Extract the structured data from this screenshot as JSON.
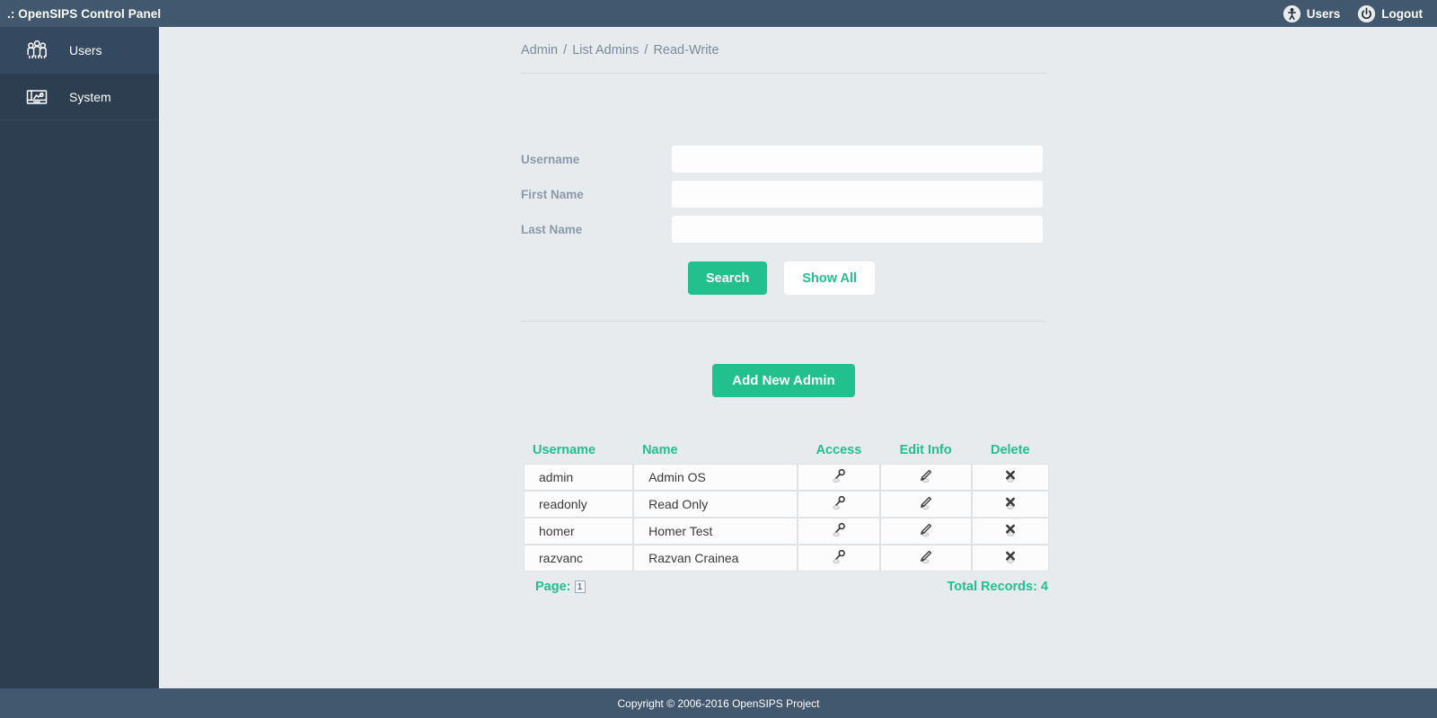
{
  "app": {
    "title": ".: OpenSIPS Control Panel",
    "header_links": [
      {
        "label": "Users",
        "icon": "person-circle-icon"
      },
      {
        "label": "Logout",
        "icon": "power-icon"
      }
    ]
  },
  "sidebar": {
    "items": [
      {
        "label": "Users",
        "icon": "people-group-icon",
        "active": true
      },
      {
        "label": "System",
        "icon": "system-monitor-icon",
        "active": false
      }
    ]
  },
  "breadcrumb": {
    "parts": [
      "Admin",
      "List Admins",
      "Read-Write"
    ],
    "separator": "/"
  },
  "search_form": {
    "fields": [
      {
        "label": "Username",
        "value": "",
        "placeholder": ""
      },
      {
        "label": "First Name",
        "value": "",
        "placeholder": ""
      },
      {
        "label": "Last Name",
        "value": "",
        "placeholder": ""
      }
    ],
    "search_label": "Search",
    "show_all_label": "Show All"
  },
  "actions": {
    "add_new_label": "Add New Admin"
  },
  "table": {
    "columns": [
      "Username",
      "Name",
      "Access",
      "Edit Info",
      "Delete"
    ],
    "rows": [
      {
        "username": "admin",
        "name": "Admin OS",
        "access_icon": "key-icon",
        "edit_icon": "pencil-icon",
        "delete_icon": "cross-icon"
      },
      {
        "username": "readonly",
        "name": "Read Only",
        "access_icon": "key-icon",
        "edit_icon": "pencil-icon",
        "delete_icon": "cross-icon"
      },
      {
        "username": "homer",
        "name": "Homer Test",
        "access_icon": "key-icon",
        "edit_icon": "pencil-icon",
        "delete_icon": "cross-icon"
      },
      {
        "username": "razvanc",
        "name": "Razvan Crainea",
        "access_icon": "key-icon",
        "edit_icon": "pencil-icon",
        "delete_icon": "cross-icon"
      }
    ],
    "page_label": "Page:",
    "page_number": "1",
    "total_records_label": "Total Records: 4"
  },
  "footer": {
    "copyright": "Copyright © 2006-2016 OpenSIPS Project"
  },
  "colors": {
    "header_bar": "#41586f",
    "sidebar": "#2d3e50",
    "accent_green": "#21c08d",
    "content_bg": "#e8ebee",
    "label_gray": "#8b99a9"
  }
}
